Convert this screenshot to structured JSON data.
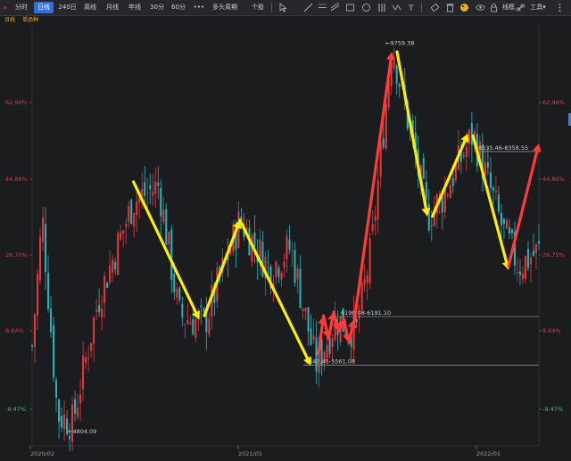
{
  "toolbar": {
    "buttons": [
      "分时",
      "日线",
      "240日",
      "周线",
      "月线",
      "年线",
      "30分",
      "60分",
      "•••",
      "多头周期",
      "个股"
    ],
    "active_index": 1,
    "settings_label": "线框",
    "tools_label": "工具▾"
  },
  "subbar": {
    "period_label": "日线",
    "mode_label": "单品种"
  },
  "colors": {
    "up": "#e8393b",
    "down": "#2bb4b8",
    "arrow_up": "#ff3b3b",
    "arrow_down": "#ffee00",
    "pct_up": "#e8393b",
    "pct_down": "#2fd05a",
    "grid": "#2c2d33"
  },
  "chart_data": {
    "type": "candlestick-annotated",
    "price_range": [
      4500,
      10000
    ],
    "left_labels": [
      "62.96%",
      "44.86%",
      "26.75%",
      "8.64%",
      "-9.47%"
    ],
    "right_labels": [
      "62.96%",
      "44.86%",
      "26.75%",
      "8.64%",
      "-9.47%"
    ],
    "x_labels": [
      "2020/02",
      "2021/01",
      "2022/01"
    ],
    "annotations": {
      "high": "9759.38",
      "low": "4804.09",
      "level1": "8335.46-8358.55",
      "level2": "6190.08-6191.10",
      "level3": "5547.45-5561.08"
    },
    "anchors": [
      {
        "pos": 0.0,
        "price": 5800
      },
      {
        "pos": 0.02,
        "price": 7500
      },
      {
        "pos": 0.05,
        "price": 4900
      },
      {
        "pos": 0.08,
        "price": 4804
      },
      {
        "pos": 0.13,
        "price": 6400
      },
      {
        "pos": 0.2,
        "price": 7700
      },
      {
        "pos": 0.25,
        "price": 7900
      },
      {
        "pos": 0.29,
        "price": 6200
      },
      {
        "pos": 0.34,
        "price": 6100
      },
      {
        "pos": 0.41,
        "price": 7450
      },
      {
        "pos": 0.47,
        "price": 6800
      },
      {
        "pos": 0.51,
        "price": 7100
      },
      {
        "pos": 0.56,
        "price": 5560
      },
      {
        "pos": 0.6,
        "price": 6150
      },
      {
        "pos": 0.64,
        "price": 6000
      },
      {
        "pos": 0.67,
        "price": 7100
      },
      {
        "pos": 0.71,
        "price": 9759
      },
      {
        "pos": 0.74,
        "price": 8800
      },
      {
        "pos": 0.78,
        "price": 7500
      },
      {
        "pos": 0.81,
        "price": 7750
      },
      {
        "pos": 0.87,
        "price": 8580
      },
      {
        "pos": 0.93,
        "price": 7300
      },
      {
        "pos": 0.96,
        "price": 6850
      },
      {
        "pos": 1.0,
        "price": 7050
      }
    ],
    "arrows_yellow": [
      {
        "from": {
          "pos": 0.2,
          "price": 7950
        },
        "to": {
          "pos": 0.33,
          "price": 6150
        }
      },
      {
        "from": {
          "pos": 0.34,
          "price": 6200
        },
        "to": {
          "pos": 0.41,
          "price": 7450
        }
      },
      {
        "from": {
          "pos": 0.41,
          "price": 7450
        },
        "to": {
          "pos": 0.55,
          "price": 5550
        }
      },
      {
        "from": {
          "pos": 0.72,
          "price": 9650
        },
        "to": {
          "pos": 0.78,
          "price": 7500
        }
      },
      {
        "from": {
          "pos": 0.79,
          "price": 7500
        },
        "to": {
          "pos": 0.86,
          "price": 8580
        }
      },
      {
        "from": {
          "pos": 0.87,
          "price": 8550
        },
        "to": {
          "pos": 0.94,
          "price": 6800
        }
      }
    ],
    "arrows_red": [
      {
        "from": {
          "pos": 0.635,
          "price": 6100
        },
        "to": {
          "pos": 0.71,
          "price": 9650
        }
      },
      {
        "from": {
          "pos": 0.94,
          "price": 6850
        },
        "to": {
          "pos": 1.0,
          "price": 8450
        }
      }
    ],
    "red_zigzag": [
      {
        "pos": 0.565,
        "price": 5700
      },
      {
        "pos": 0.575,
        "price": 6200
      },
      {
        "pos": 0.585,
        "price": 5900
      },
      {
        "pos": 0.595,
        "price": 6250
      },
      {
        "pos": 0.605,
        "price": 6000
      },
      {
        "pos": 0.615,
        "price": 6150
      },
      {
        "pos": 0.625,
        "price": 5850
      },
      {
        "pos": 0.635,
        "price": 6150
      }
    ]
  }
}
